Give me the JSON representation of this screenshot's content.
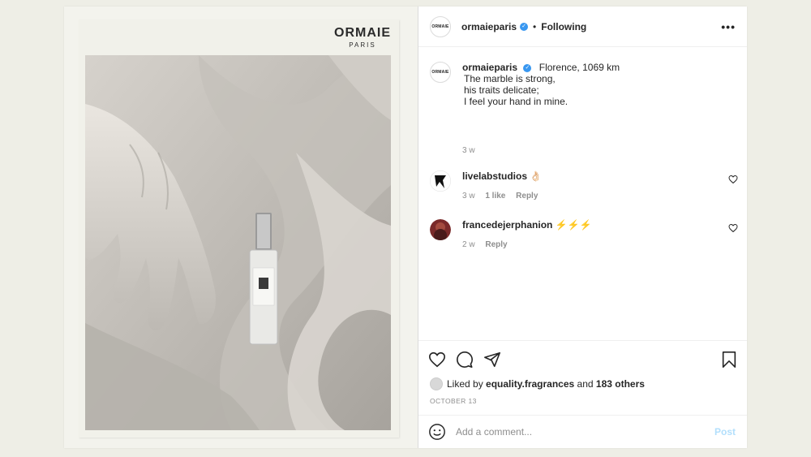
{
  "brand": {
    "name": "ORMAIE",
    "city": "PARIS"
  },
  "header": {
    "avatar_text": "ORMAIE",
    "username": "ormaieparis",
    "separator": "•",
    "follow_status": "Following",
    "more_icon": "more-horizontal-icon"
  },
  "caption": {
    "avatar_text": "ORMAIE",
    "username": "ormaieparis",
    "location": "Florence,",
    "distance": "1069 km",
    "line1": "The marble is strong,",
    "line2": "his traits delicate;",
    "line3": "I feel your hand in mine.",
    "time": "3 w"
  },
  "comments": [
    {
      "username": "livelabstudios",
      "text": "👌🏻",
      "time": "3 w",
      "likes": "1 like",
      "reply": "Reply"
    },
    {
      "username": "francedejerphanion",
      "text": "⚡⚡⚡",
      "time": "2 w",
      "reply": "Reply"
    }
  ],
  "actions": {
    "liked_prefix": "Liked by",
    "liked_user": "equality.fragrances",
    "liked_and": "and",
    "liked_others": "183 others",
    "date": "OCTOBER 13"
  },
  "add_comment": {
    "emoji_icon": "smiley-icon",
    "placeholder": "Add a comment...",
    "post_label": "Post"
  },
  "colors": {
    "verified": "#3897f0",
    "post_disabled": "#b2dffc",
    "muted": "#8e8e8e"
  }
}
